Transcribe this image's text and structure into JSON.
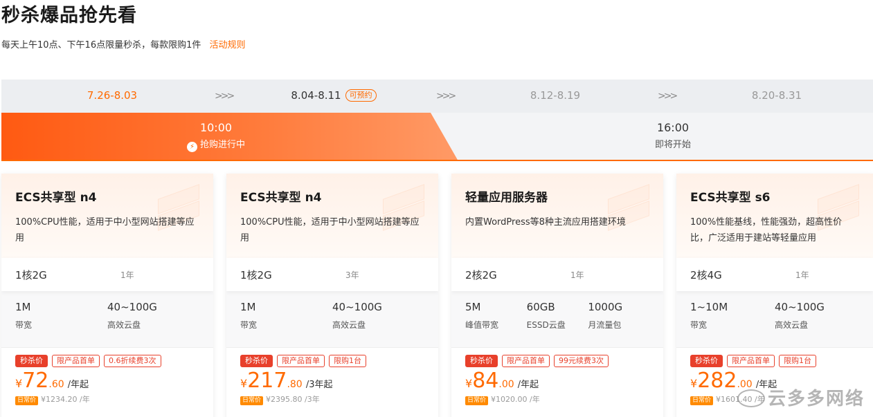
{
  "page": {
    "title": "秒杀爆品抢先看",
    "subtitle": "每天上午10点、下午16点限量秒杀，每款限购1件",
    "rules_link": "活动规则"
  },
  "date_tabs": [
    {
      "label": "7.26-8.03",
      "state": "active"
    },
    {
      "label": "8.04-8.11",
      "state": "current",
      "badge": "可预约"
    },
    {
      "label": "8.12-8.19",
      "state": "future"
    },
    {
      "label": "8.20-8.31",
      "state": "future"
    }
  ],
  "date_separator": ">>>",
  "time_slots": [
    {
      "time": "10:00",
      "state_label": "抢购进行中",
      "active": true
    },
    {
      "time": "16:00",
      "state_label": "即将开始",
      "active": false
    }
  ],
  "cards": [
    {
      "name": "ECS共享型 n4",
      "desc": "100%CPU性能，适用于中小型网站搭建等应用",
      "spec": "1核2G",
      "term": "1年",
      "attrs": [
        {
          "v": "1M",
          "k": "带宽"
        },
        {
          "v": "40~100G",
          "k": "高效云盘"
        }
      ],
      "tags": [
        "秒杀价",
        "限产品首单",
        "0.6折续费3次"
      ],
      "currency": "¥",
      "price_int": "72",
      "price_dec": ".60",
      "price_unit": "/年起",
      "daily_tag": "日常价",
      "daily_price": "¥1234.20 /年"
    },
    {
      "name": "ECS共享型 n4",
      "desc": "100%CPU性能，适用于中小型网站搭建等应用",
      "spec": "1核2G",
      "term": "3年",
      "attrs": [
        {
          "v": "1M",
          "k": "带宽"
        },
        {
          "v": "40~100G",
          "k": "高效云盘"
        }
      ],
      "tags": [
        "秒杀价",
        "限产品首单",
        "限购1台"
      ],
      "currency": "¥",
      "price_int": "217",
      "price_dec": ".80",
      "price_unit": "/3年起",
      "daily_tag": "日常价",
      "daily_price": "¥2395.80 /3年"
    },
    {
      "name": "轻量应用服务器",
      "desc": "内置WordPress等8种主流应用搭建环境",
      "spec": "2核2G",
      "term": "1年",
      "attrs": [
        {
          "v": "5M",
          "k": "峰值带宽"
        },
        {
          "v": "60GB",
          "k": "ESSD云盘"
        },
        {
          "v": "1000G",
          "k": "月流量包"
        }
      ],
      "tags": [
        "秒杀价",
        "限产品首单",
        "99元续费3次"
      ],
      "currency": "¥",
      "price_int": "84",
      "price_dec": ".00",
      "price_unit": "/年起",
      "daily_tag": "日常价",
      "daily_price": "¥1020.00 /年"
    },
    {
      "name": "ECS共享型 s6",
      "desc": "100%性能基线，性能强劲，超高性价比，广泛适用于建站等轻量应用",
      "spec": "2核4G",
      "term": "1年",
      "attrs": [
        {
          "v": "1~10M",
          "k": "带宽"
        },
        {
          "v": "40~100G",
          "k": "高效云盘"
        }
      ],
      "tags": [
        "秒杀价",
        "限产品首单",
        "限购1台"
      ],
      "currency": "¥",
      "price_int": "282",
      "price_dec": ".00",
      "price_unit": "/年起",
      "daily_tag": "日常价",
      "daily_price": "¥1601.40 /年"
    }
  ],
  "watermark": "云多多网络",
  "colors": {
    "accent": "#ff6a00",
    "tag_red": "#e8402b",
    "date_bar": "#eceef1"
  }
}
